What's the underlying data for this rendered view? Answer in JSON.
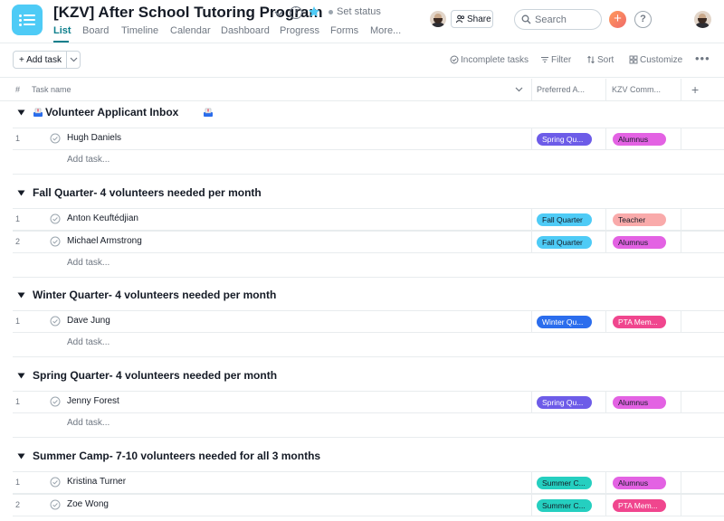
{
  "header": {
    "project_title": "[KZV] After School Tutoring Program",
    "set_status": "Set status",
    "share_label": "Share",
    "search_placeholder": "Search",
    "help_label": "?",
    "plus_label": "+",
    "tabs": [
      {
        "label": "List",
        "active": true
      },
      {
        "label": "Board"
      },
      {
        "label": "Timeline"
      },
      {
        "label": "Calendar"
      },
      {
        "label": "Dashboard"
      },
      {
        "label": "Progress"
      },
      {
        "label": "Forms"
      },
      {
        "label": "More..."
      }
    ],
    "accent_color": "#0d7f8c"
  },
  "toolbar": {
    "add_task": "+ Add task",
    "incomplete": "Incomplete tasks",
    "filter": "Filter",
    "sort": "Sort",
    "customize": "Customize",
    "more": "•••"
  },
  "columns": {
    "index": "#",
    "task_name": "Task name",
    "preferred": "Preferred A...",
    "kzv": "KZV Comm...",
    "add": "+"
  },
  "add_task_row": "Add task...",
  "sections": [
    {
      "title": "Volunteer Applicant Inbox",
      "has_inbox_emoji": true,
      "tasks": [
        {
          "index": "1",
          "name": "Hugh Daniels",
          "preferred": "Spring Qu...",
          "preferred_color": "#6d5ce8",
          "kzv": "Alumnus",
          "kzv_color": "#e362e3"
        }
      ]
    },
    {
      "title": "Fall Quarter- 4 volunteers needed per month",
      "tasks": [
        {
          "index": "1",
          "name": "Anton Keuftédjian",
          "preferred": "Fall Quarter",
          "preferred_color": "#4ecbf6",
          "kzv": "Teacher",
          "kzv_color": "#f9aaaa"
        },
        {
          "index": "2",
          "name": "Michael Armstrong",
          "preferred": "Fall Quarter",
          "preferred_color": "#4ecbf6",
          "kzv": "Alumnus",
          "kzv_color": "#e362e3"
        }
      ]
    },
    {
      "title": "Winter Quarter- 4 volunteers needed per month",
      "tasks": [
        {
          "index": "1",
          "name": "Dave Jung",
          "preferred": "Winter Qu...",
          "preferred_color": "#2b6ded",
          "kzv": "PTA Mem...",
          "kzv_color": "#f0468e"
        }
      ]
    },
    {
      "title": "Spring Quarter- 4 volunteers needed per month",
      "tasks": [
        {
          "index": "1",
          "name": "Jenny Forest",
          "preferred": "Spring Qu...",
          "preferred_color": "#6d5ce8",
          "kzv": "Alumnus",
          "kzv_color": "#e362e3"
        }
      ]
    },
    {
      "title": "Summer Camp- 7-10 volunteers needed for all 3 months",
      "tasks": [
        {
          "index": "1",
          "name": "Kristina Turner",
          "preferred": "Summer C...",
          "preferred_color": "#25cfc0",
          "kzv": "Alumnus",
          "kzv_color": "#e362e3"
        },
        {
          "index": "2",
          "name": "Zoe Wong",
          "preferred": "Summer C...",
          "preferred_color": "#25cfc0",
          "kzv": "PTA Mem...",
          "kzv_color": "#f0468e"
        }
      ]
    }
  ]
}
